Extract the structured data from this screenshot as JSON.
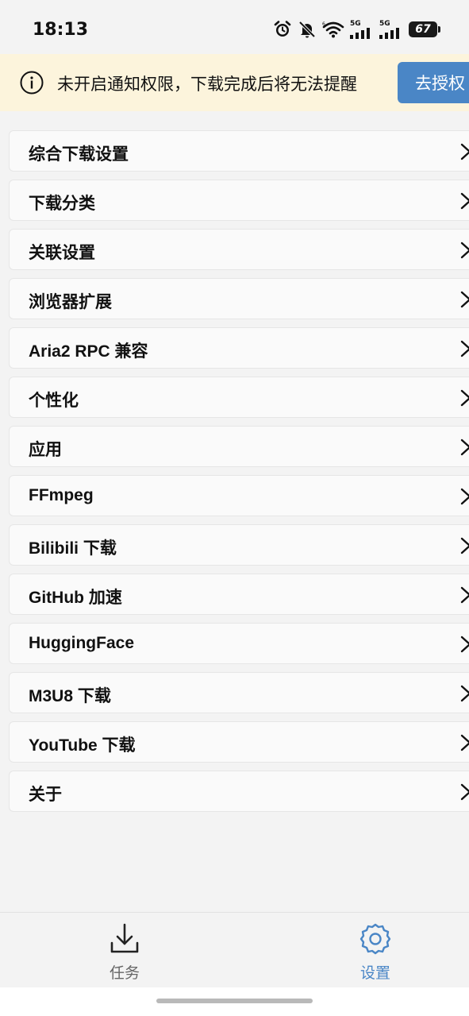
{
  "status_bar": {
    "time": "18:13",
    "network_label_1": "5G",
    "network_label_2": "5G",
    "battery": "67",
    "icons": [
      "alarm-icon",
      "bell-off-icon",
      "wifi-icon",
      "signal-icon",
      "signal-icon",
      "battery-icon"
    ]
  },
  "banner": {
    "icon": "info-icon",
    "message": "未开启通知权限，下载完成后将无法提醒",
    "button_label": "去授权"
  },
  "menu": {
    "items": [
      {
        "label": "综合下载设置"
      },
      {
        "label": "下载分类"
      },
      {
        "label": "关联设置"
      },
      {
        "label": "浏览器扩展"
      },
      {
        "label": "Aria2 RPC 兼容"
      },
      {
        "label": "个性化"
      },
      {
        "label": "应用"
      },
      {
        "label": "FFmpeg"
      },
      {
        "label": "Bilibili 下载"
      },
      {
        "label": "GitHub 加速"
      },
      {
        "label": "HuggingFace"
      },
      {
        "label": "M3U8 下载"
      },
      {
        "label": "YouTube 下载"
      },
      {
        "label": "关于"
      }
    ],
    "chevron_icon": "chevron-right-icon"
  },
  "bottom_nav": {
    "tabs": [
      {
        "label": "任务",
        "icon": "download-icon",
        "active": false
      },
      {
        "label": "设置",
        "icon": "gear-icon",
        "active": true
      }
    ]
  },
  "colors": {
    "accent": "#4a86c6",
    "banner_bg": "#fcf4dc",
    "page_bg": "#f3f3f3"
  }
}
